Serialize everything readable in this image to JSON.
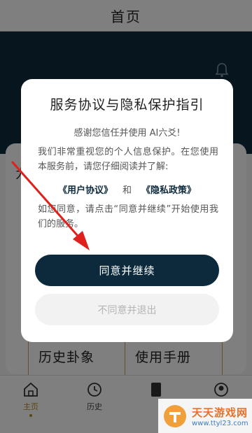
{
  "app": {
    "title": "首页",
    "peek_title": "为",
    "tiles": [
      "历史卦象",
      "使用手册"
    ]
  },
  "tabbar": {
    "tabs": [
      {
        "label": "主页",
        "icon": "home-icon",
        "active": true
      },
      {
        "label": "历史",
        "icon": "history-icon",
        "active": false
      },
      {
        "label": "",
        "icon": "book-icon",
        "active": false
      },
      {
        "label": "",
        "icon": "user-icon",
        "active": false
      }
    ]
  },
  "dialog": {
    "title": "服务协议与隐私保护指引",
    "thanks": "感谢您信任并使用 AI六爻!",
    "body": "我们非常重视您的个人信息保护。在您使用本服务前，请您仔细阅读并了解:",
    "link_agreement": "《用户协议》",
    "and": "和",
    "link_privacy": "《隐私政策》",
    "footer": "如您同意，请点击“同意并继续”开始使用我们的服务。",
    "agree_label": "同意并继续",
    "disagree_label": "不同意并退出"
  },
  "watermark": {
    "name": "天天游戏网",
    "url": "www.ttyl23.com"
  },
  "colors": {
    "accent": "#0d2a3c",
    "gold": "#b88a28",
    "annotation_red": "#e0201c"
  }
}
